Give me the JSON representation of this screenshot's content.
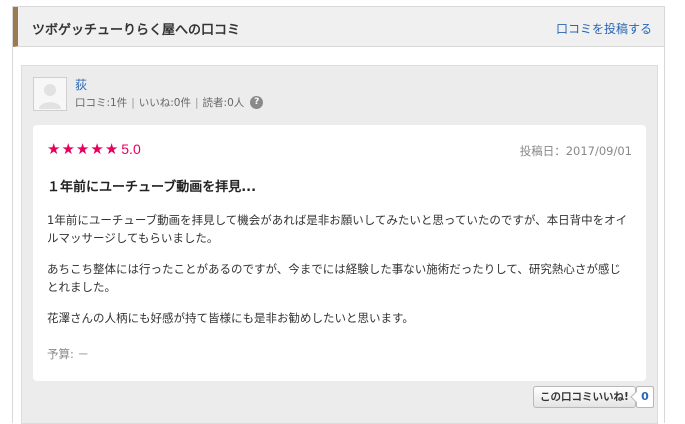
{
  "header": {
    "title": "ツボゲッチューりらく屋への口コミ",
    "post_link": "口コミを投稿する"
  },
  "user": {
    "name": "荻",
    "reviews": "口コミ:1件",
    "likes": "いいね:0件",
    "readers": "読者:0人",
    "help": "?"
  },
  "review": {
    "stars": [
      "★",
      "★",
      "★",
      "★",
      "★"
    ],
    "score": "5.0",
    "date": "投稿日：2017/09/01",
    "title": "１年前にユーチューブ動画を拝見...",
    "paragraphs": [
      "1年前にユーチューブ動画を拝見して機会があれば是非お願いしてみたいと思っていたのですが、本日背中をオイルマッサージしてもらいました。",
      "あちこち整体には行ったことがあるのですが、今までには経験した事ない施術だったりして、研究熱心さが感じとれました。",
      "花澤さんの人柄にも好感が持て皆様にも是非お勧めしたいと思います。"
    ],
    "budget": "予算: －",
    "star_color": "#e6005c"
  },
  "like": {
    "button_label": "この口コミいいね!",
    "count": "0"
  }
}
